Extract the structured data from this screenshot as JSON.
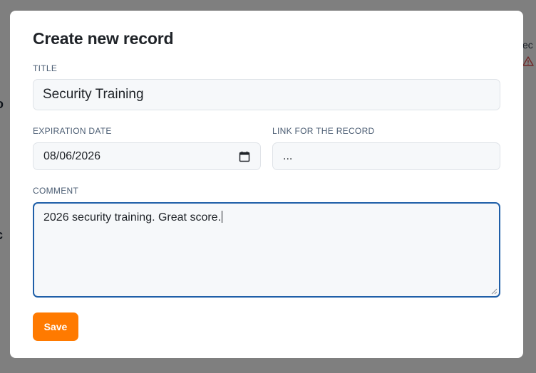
{
  "background": {
    "left_text_1": "o",
    "left_text_2": "c",
    "right_text": "ec"
  },
  "modal": {
    "title": "Create new record",
    "fields": {
      "title": {
        "label": "TITLE",
        "value": "Security Training"
      },
      "expiration_date": {
        "label": "EXPIRATION DATE",
        "value": "08/06/2026"
      },
      "link": {
        "label": "LINK FOR THE RECORD",
        "value": "..."
      },
      "comment": {
        "label": "COMMENT",
        "value": "2026 security training. Great score."
      }
    },
    "save_label": "Save"
  },
  "colors": {
    "accent": "#ff7a00",
    "focus_border": "#1f5fa8",
    "label": "#4b5d73",
    "input_bg": "#f6f8fa"
  },
  "icons": {
    "calendar": "calendar-icon",
    "warning": "warning-icon"
  }
}
